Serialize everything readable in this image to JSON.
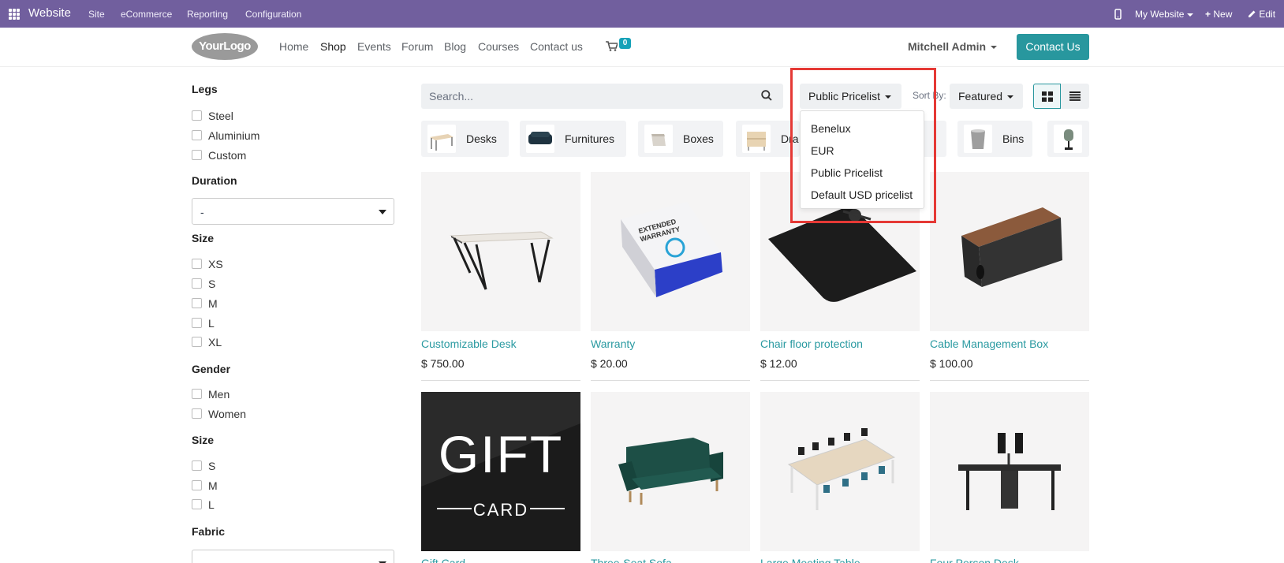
{
  "topbar": {
    "brand": "Website",
    "menu": [
      "Site",
      "eCommerce",
      "Reporting",
      "Configuration"
    ],
    "my_website": "My Website",
    "new": "New",
    "edit": "Edit",
    "bg_color": "#715f9e"
  },
  "header": {
    "logo_text": "YourLogo",
    "nav": [
      "Home",
      "Shop",
      "Events",
      "Forum",
      "Blog",
      "Courses",
      "Contact us"
    ],
    "active_nav": "Shop",
    "cart_count": "0",
    "user": "Mitchell Admin",
    "contact_button": "Contact Us"
  },
  "sidebar": {
    "legs": {
      "title": "Legs",
      "options": [
        "Steel",
        "Aluminium",
        "Custom"
      ]
    },
    "duration": {
      "title": "Duration",
      "value": "-"
    },
    "size": {
      "title": "Size",
      "options": [
        "XS",
        "S",
        "M",
        "L",
        "XL"
      ]
    },
    "gender": {
      "title": "Gender",
      "options": [
        "Men",
        "Women"
      ]
    },
    "size2": {
      "title": "Size",
      "options": [
        "S",
        "M",
        "L"
      ]
    },
    "fabric": {
      "title": "Fabric",
      "value": "-"
    }
  },
  "toolbar": {
    "search_placeholder": "Search...",
    "pricelist": "Public Pricelist",
    "sort_label": "Sort By:",
    "sort_value": "Featured"
  },
  "categories": [
    "Desks",
    "Furnitures",
    "Boxes",
    "Drawers",
    "Cabinets",
    "Bins",
    "Lamps"
  ],
  "categories_visible": [
    "Desks",
    "Furnitures",
    "Boxes",
    "Dra",
    "ets",
    "Bins"
  ],
  "pricelist_menu": [
    "Benelux",
    "EUR",
    "Public Pricelist",
    "Default USD pricelist"
  ],
  "products": [
    {
      "name": "Customizable Desk",
      "price": "$ 750.00"
    },
    {
      "name": "Warranty",
      "price": "$ 20.00"
    },
    {
      "name": "Chair floor protection",
      "price": "$ 12.00"
    },
    {
      "name": "Cable Management Box",
      "price": "$ 100.00"
    },
    {
      "name": "Gift Card",
      "price": ""
    },
    {
      "name": "Three-Seat Sofa",
      "price": ""
    },
    {
      "name": "Large Meeting Table",
      "price": ""
    },
    {
      "name": "Four Person Desk",
      "price": ""
    }
  ],
  "gift_card_text": {
    "big": "GIFT",
    "small": "CARD"
  },
  "warranty_text": "EXTENDED WARRANTY",
  "colors": {
    "accent": "#28979e",
    "link": "#2a9aa1",
    "highlight": "#e53935"
  }
}
